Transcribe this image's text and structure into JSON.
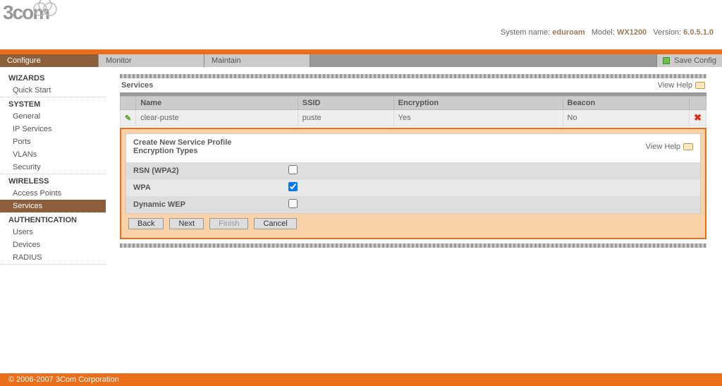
{
  "header": {
    "brand": "3com",
    "sys_name_label": "System name:",
    "sys_name": "eduroam",
    "model_label": "Model:",
    "model": "WX1200",
    "version_label": "Version:",
    "version": "6.0.5.1.0"
  },
  "tabs": {
    "configure": "Configure",
    "monitor": "Monitor",
    "maintain": "Maintain",
    "save_config": "Save Config"
  },
  "sidebar": {
    "wizards": {
      "title": "WIZARDS",
      "items": [
        "Quick Start"
      ]
    },
    "system": {
      "title": "SYSTEM",
      "items": [
        "General",
        "IP Services",
        "Ports",
        "VLANs",
        "Security"
      ]
    },
    "wireless": {
      "title": "WIRELESS",
      "items": [
        "Access Points",
        "Services"
      ]
    },
    "auth": {
      "title": "AUTHENTICATION",
      "items": [
        "Users",
        "Devices",
        "RADIUS"
      ]
    }
  },
  "main": {
    "section_title": "Services",
    "view_help": "View Help",
    "table": {
      "cols": {
        "name": "Name",
        "ssid": "SSID",
        "enc": "Encryption",
        "beacon": "Beacon"
      },
      "row": {
        "name": "clear-puste",
        "ssid": "puste",
        "enc": "Yes",
        "beacon": "No"
      }
    },
    "wizard": {
      "title_line1": "Create New Service Profile",
      "title_line2": "Encryption Types",
      "opts": {
        "rsn": "RSN (WPA2)",
        "wpa": "WPA",
        "dwep": "Dynamic WEP"
      },
      "checked": {
        "rsn": false,
        "wpa": true,
        "dwep": false
      },
      "buttons": {
        "back": "Back",
        "next": "Next",
        "finish": "Finish",
        "cancel": "Cancel"
      }
    }
  },
  "footer": {
    "copyright": "© 2006-2007 3Com Corporation"
  }
}
